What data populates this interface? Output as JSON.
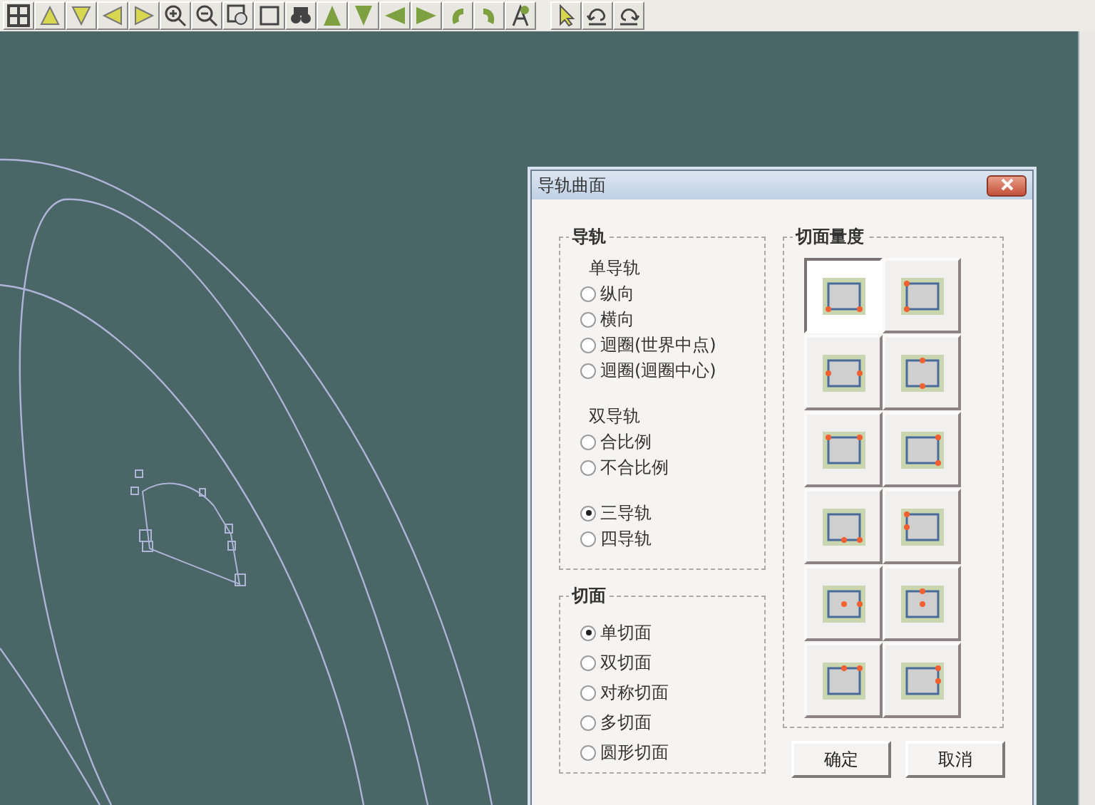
{
  "dialog": {
    "title": "导轨曲面",
    "rail_group": {
      "title": "导轨",
      "sections": [
        {
          "heading": "单导轨",
          "options": [
            {
              "label": "纵向",
              "selected": false
            },
            {
              "label": "横向",
              "selected": false
            },
            {
              "label": "迴圈(世界中点)",
              "selected": false
            },
            {
              "label": "迴圈(迴圈中心)",
              "selected": false
            }
          ]
        },
        {
          "heading": "双导轨",
          "options": [
            {
              "label": "合比例",
              "selected": false
            },
            {
              "label": "不合比例",
              "selected": false
            }
          ]
        },
        {
          "options": [
            {
              "label": "三导轨",
              "selected": true
            },
            {
              "label": "四导轨",
              "selected": false
            }
          ]
        }
      ]
    },
    "section_group": {
      "title": "切面",
      "options": [
        {
          "label": "单切面",
          "selected": true
        },
        {
          "label": "双切面",
          "selected": false
        },
        {
          "label": "对称切面",
          "selected": false
        },
        {
          "label": "多切面",
          "selected": false
        },
        {
          "label": "圆形切面",
          "selected": false
        }
      ]
    },
    "measure_group": {
      "title": "切面量度",
      "tiles": [
        {
          "selected": true
        },
        {
          "selected": false
        },
        {
          "selected": false
        },
        {
          "selected": false
        },
        {
          "selected": false
        },
        {
          "selected": false
        },
        {
          "selected": false
        },
        {
          "selected": false
        },
        {
          "selected": false
        },
        {
          "selected": false
        },
        {
          "selected": false
        },
        {
          "selected": false
        }
      ]
    },
    "buttons": [
      "确定",
      "取消"
    ]
  }
}
